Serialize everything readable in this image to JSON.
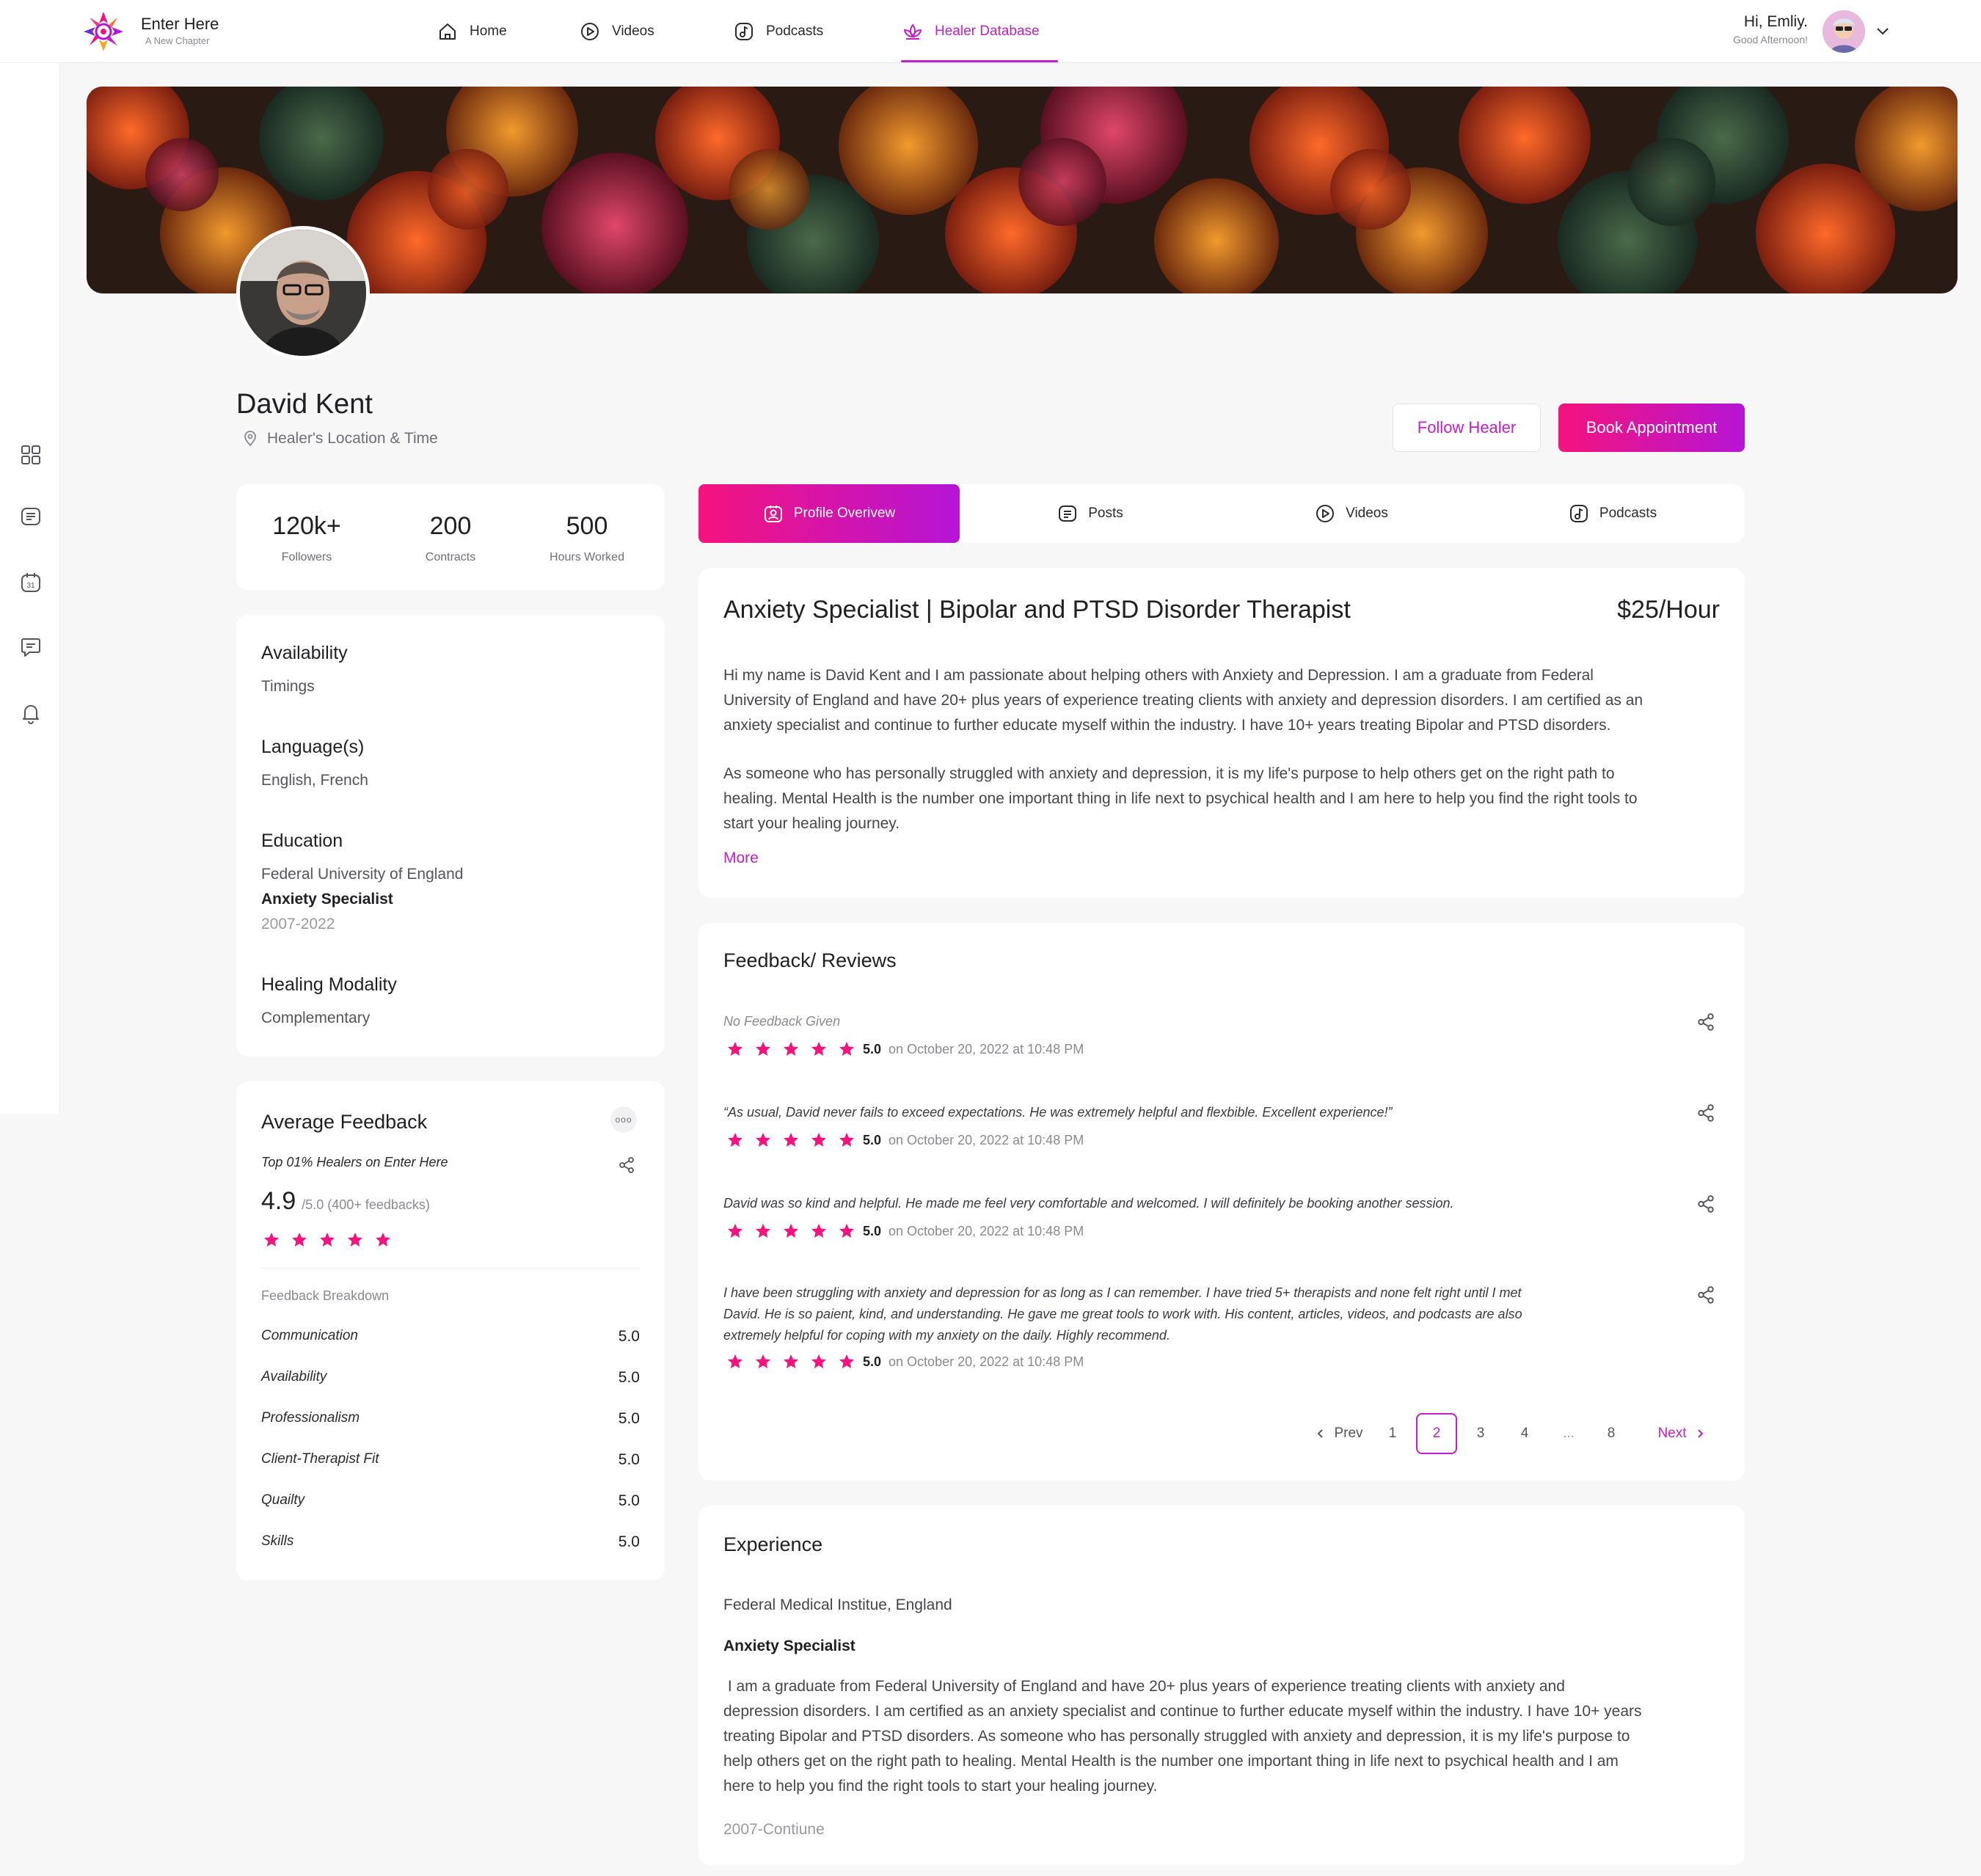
{
  "brand": {
    "name": "Enter Here",
    "tagline": "A New Chapter"
  },
  "nav": {
    "items": [
      {
        "label": "Home",
        "icon": "home-icon"
      },
      {
        "label": "Videos",
        "icon": "video-icon"
      },
      {
        "label": "Podcasts",
        "icon": "podcast-icon"
      },
      {
        "label": "Healer Database",
        "icon": "lotus-icon",
        "active": true
      }
    ]
  },
  "user": {
    "greeting": "Hi, Emliy.",
    "sub": "Good Afternoon!"
  },
  "rail": {
    "icons": [
      "dashboard-icon",
      "notes-icon",
      "calendar-icon",
      "chat-icon",
      "bell-icon"
    ],
    "calendar_day": "31"
  },
  "healer": {
    "name": "David Kent",
    "location": "Healer's Location & Time",
    "follow_label": "Follow Healer",
    "book_label": "Book Appointment"
  },
  "stats": [
    {
      "value": "120k+",
      "label": "Followers"
    },
    {
      "value": "200",
      "label": "Contracts"
    },
    {
      "value": "500",
      "label": "Hours Worked"
    }
  ],
  "info": {
    "availability_h": "Availability",
    "availability_v": "Timings",
    "language_h": "Language(s)",
    "language_v": "English, French",
    "education_h": "Education",
    "education_school": "Federal University of England",
    "education_degree": "Anxiety Specialist",
    "education_years": "2007-2022",
    "modality_h": "Healing Modality",
    "modality_v": "Complementary"
  },
  "avg_feedback": {
    "title": "Average Feedback",
    "menu": "ooo",
    "rank": "Top 01% Healers on Enter Here",
    "score": "4.9",
    "out_of": "/5.0 (400+ feedbacks)",
    "stars": 5,
    "breakdown_title": "Feedback Breakdown",
    "breakdown": [
      {
        "name": "Communication",
        "score": "5.0"
      },
      {
        "name": "Availability",
        "score": "5.0"
      },
      {
        "name": "Professionalism",
        "score": "5.0"
      },
      {
        "name": "Client-Therapist Fit",
        "score": "5.0"
      },
      {
        "name": "Quailty",
        "score": "5.0"
      },
      {
        "name": "Skills",
        "score": "5.0"
      }
    ]
  },
  "tabs": [
    {
      "label": "Profile Overivew",
      "icon": "profile-icon",
      "active": true
    },
    {
      "label": "Posts",
      "icon": "posts-icon"
    },
    {
      "label": "Videos",
      "icon": "video-icon"
    },
    {
      "label": "Podcasts",
      "icon": "podcast-icon"
    }
  ],
  "overview": {
    "title": "Anxiety Specialist | Bipolar and PTSD Disorder Therapist",
    "rate": "$25/Hour",
    "p1_l1": "Hi my name is David Kent and I am passionate about helping others with Anxiety and Depression. I am a graduate from Federal",
    "p1_l2": "University of England and have 20+ plus years of experience treating clients with anxiety and depression disorders. I am certified as an",
    "p1_l3": "anxiety specialist and continue to further educate myself within the industry. I have 10+ years treating Bipolar and PTSD disorders.",
    "p2_l1": "As someone who has personally struggled with anxiety and depression, it is my life's purpose to help others get on the right path to",
    "p2_l2": "healing. Mental Health is the number one important thing in life next to psychical health and I am here to help you find the right tools to",
    "p2_l3": "start your healing journey.",
    "more": "More"
  },
  "reviews": {
    "title": "Feedback/ Reviews",
    "items": [
      {
        "text": "No Feedback Given",
        "muted": true,
        "score": "5.0",
        "date": "on October 20, 2022 at 10:48 PM",
        "stars": 5
      },
      {
        "text": "“As usual, David never fails to exceed expectations. He was extremely helpful and flexbible. Excellent experience!”",
        "score": "5.0",
        "date": "on October 20, 2022 at 10:48 PM",
        "stars": 5
      },
      {
        "text": "David was so kind and helpful. He made me feel very comfortable and welcomed. I will definitely be booking another session.",
        "score": "5.0",
        "date": "on October 20, 2022 at 10:48 PM",
        "stars": 5
      },
      {
        "text_l1": "I have been struggling with anxiety and depression for as long as I can remember. I have tried 5+ therapists and none felt right until I met",
        "text_l2": "David. He is so paient, kind, and understanding. He gave me great tools to work with. His content, articles, videos, and podcasts are also",
        "text_l3": "extremely helpful for coping with my anxiety on the daily. Highly recommend.",
        "score": "5.0",
        "date": "on October 20, 2022 at 10:48 PM",
        "stars": 5
      }
    ],
    "pagination": {
      "prev": "Prev",
      "pages": [
        "1",
        "2",
        "3",
        "4",
        "...",
        "8"
      ],
      "current": "2",
      "next": "Next"
    }
  },
  "experience": {
    "title": "Experience",
    "org": "Federal Medical Institue, England",
    "role": "Anxiety Specialist",
    "l1": " I am a graduate from Federal University of England and have 20+ plus years of experience treating clients with anxiety and",
    "l2": "depression disorders. I am certified as an anxiety specialist and continue to further educate myself within the industry. I have 10+ years",
    "l3": "treating Bipolar and PTSD disorders. As someone who has personally struggled with anxiety and depression, it is my life's purpose to",
    "l4": "help others get on the right path to healing. Mental Health is the number one important thing in life next to psychical health and I am",
    "l5": "here to help you find the right tools to start your healing journey.",
    "years": "2007-Contiune"
  },
  "colors": {
    "accent": "#c21fc9",
    "pink": "#f5137d",
    "purple": "#b515d6",
    "star": "#f5137d"
  }
}
